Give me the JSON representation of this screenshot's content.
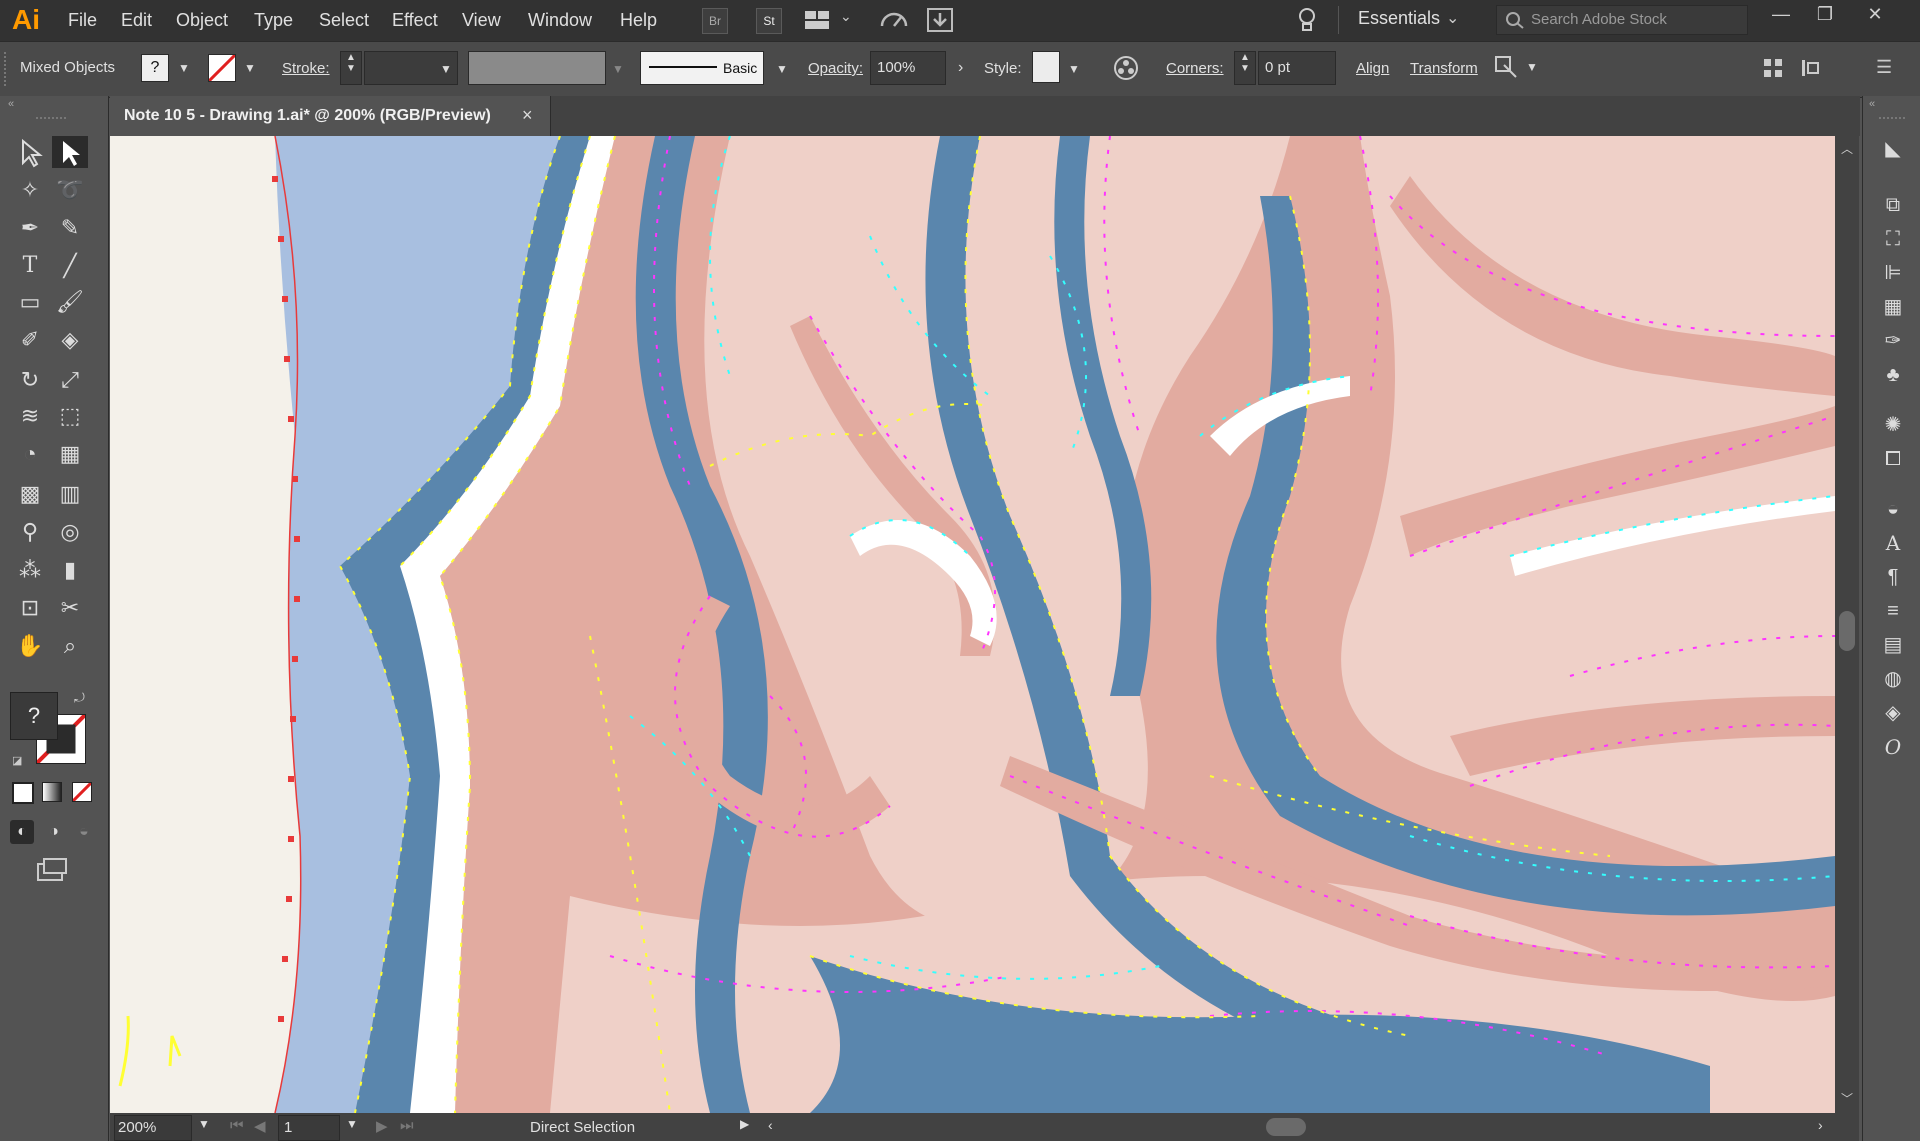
{
  "app": {
    "logo": "Ai"
  },
  "menu": [
    "File",
    "Edit",
    "Object",
    "Type",
    "Select",
    "Effect",
    "View",
    "Window",
    "Help"
  ],
  "menu_buttons": {
    "bridge": "Br",
    "stock": "St"
  },
  "workspace": "Essentials",
  "search": {
    "placeholder": "Search Adobe Stock"
  },
  "control": {
    "selection": "Mixed Objects",
    "fill_unknown": "?",
    "stroke_label": "Stroke:",
    "brush_label": "Basic",
    "opacity_label": "Opacity:",
    "opacity_value": "100%",
    "style_label": "Style:",
    "corners_label": "Corners:",
    "corners_value": "0 pt",
    "align": "Align",
    "transform": "Transform"
  },
  "document_tab": {
    "title": "Note 10 5 - Drawing 1.ai* @ 200% (RGB/Preview)",
    "close": "×"
  },
  "toolbar": {
    "fill_stroke_unknown": "?"
  },
  "status": {
    "zoom": "200%",
    "artboard": "1",
    "tool": "Direct Selection"
  },
  "colors": {
    "canvas_bg": "#f4f1ea",
    "sky": "#a8bfe0",
    "steel_blue": "#5a86ad",
    "salmon": "#e2aba0",
    "blush": "#efd0c8",
    "white": "#ffffff",
    "anchor_yellow": "#ffff33",
    "anchor_cyan": "#33ffff",
    "anchor_magenta": "#ff33ff",
    "guide_red": "#e83a3a",
    "accent_orange": "#ff9a00"
  }
}
